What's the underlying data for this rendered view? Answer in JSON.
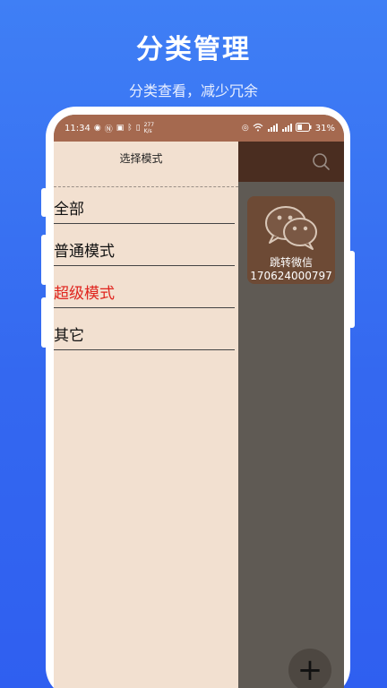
{
  "promo": {
    "title": "分类管理",
    "subtitle": "分类查看，减少冗余"
  },
  "status_bar": {
    "time": "11:34",
    "net_speed_value": "277",
    "net_speed_unit": "K/s",
    "battery": "31%",
    "left_icons": [
      "eye-icon",
      "nfc-icon",
      "app-icon",
      "bluetooth-icon",
      "vibrate-icon"
    ],
    "right_icons": [
      "hotspot-icon",
      "wifi-icon",
      "signal-5g-icon",
      "signal-4g-icon",
      "battery-icon"
    ]
  },
  "drawer": {
    "title": "选择模式",
    "items": [
      {
        "label": "全部",
        "active": false
      },
      {
        "label": "普通模式",
        "active": false
      },
      {
        "label": "超级模式",
        "active": true
      },
      {
        "label": "其它",
        "active": false
      }
    ]
  },
  "card": {
    "label": "跳转微信",
    "number": "170624000797"
  },
  "fab": {
    "label": "+"
  },
  "colors": {
    "background": "#3468f0",
    "status_bar": "#a5694f",
    "app_bar": "#4a2d20",
    "drawer": "#f2e0d0",
    "active_item": "#e0241e",
    "card": "#6d4a35"
  }
}
